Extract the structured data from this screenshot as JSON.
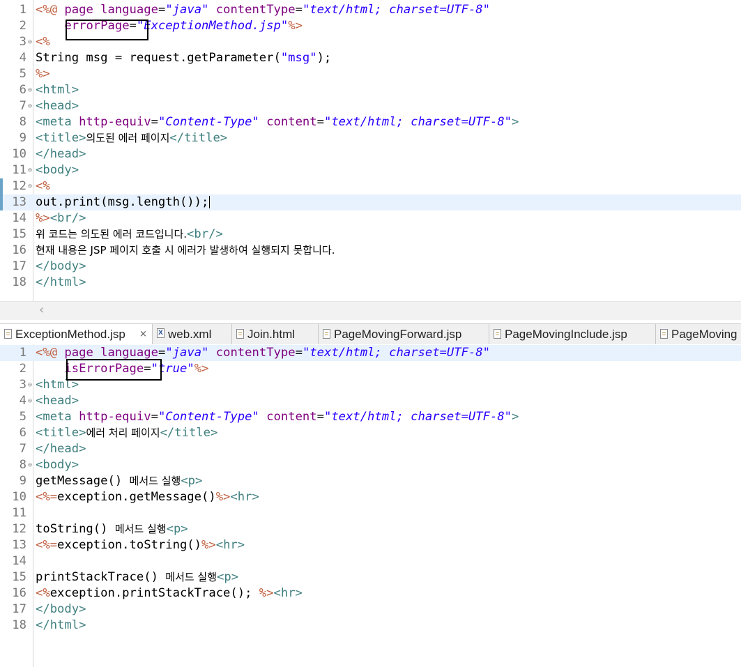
{
  "top_editor": {
    "lines": [
      {
        "n": "1",
        "fold": "",
        "parts": [
          {
            "c": "t-d",
            "t": "<%@ "
          },
          {
            "c": "t-attr",
            "t": "page "
          },
          {
            "c": "t-attr",
            "t": "language"
          },
          {
            "c": "t-eq",
            "t": "="
          },
          {
            "c": "t-str",
            "t": "\"java\""
          },
          {
            "c": "t-eq",
            "t": " "
          },
          {
            "c": "t-attr",
            "t": "contentType"
          },
          {
            "c": "t-eq",
            "t": "="
          },
          {
            "c": "t-str",
            "t": "\"text/html; charset=UTF-8\""
          }
        ]
      },
      {
        "n": "2",
        "fold": "",
        "parts": [
          {
            "c": "t-plain",
            "t": "    "
          },
          {
            "c": "t-attr",
            "t": "errorPage"
          },
          {
            "c": "t-eq",
            "t": "="
          },
          {
            "c": "t-str",
            "t": "\"ExceptionMethod.jsp\""
          },
          {
            "c": "t-d",
            "t": "%>"
          }
        ]
      },
      {
        "n": "3",
        "fold": "⊖",
        "parts": [
          {
            "c": "t-d",
            "t": "<%"
          }
        ]
      },
      {
        "n": "4",
        "fold": "",
        "parts": [
          {
            "c": "t-plain",
            "t": "String msg = request.getParameter("
          },
          {
            "c": "t-jstr",
            "t": "\"msg\""
          },
          {
            "c": "t-plain",
            "t": ");"
          }
        ]
      },
      {
        "n": "5",
        "fold": "",
        "parts": [
          {
            "c": "t-d",
            "t": "%>"
          }
        ]
      },
      {
        "n": "6",
        "fold": "⊖",
        "parts": [
          {
            "c": "t-tag",
            "t": "<html>"
          }
        ]
      },
      {
        "n": "7",
        "fold": "⊖",
        "parts": [
          {
            "c": "t-tag",
            "t": "<head>"
          }
        ]
      },
      {
        "n": "8",
        "fold": "",
        "parts": [
          {
            "c": "t-tag",
            "t": "<meta "
          },
          {
            "c": "t-attr",
            "t": "http-equiv"
          },
          {
            "c": "t-eq",
            "t": "="
          },
          {
            "c": "t-str",
            "t": "\"Content-Type\""
          },
          {
            "c": "t-eq",
            "t": " "
          },
          {
            "c": "t-attr",
            "t": "content"
          },
          {
            "c": "t-eq",
            "t": "="
          },
          {
            "c": "t-str",
            "t": "\"text/html; charset=UTF-8\""
          },
          {
            "c": "t-tag",
            "t": ">"
          }
        ]
      },
      {
        "n": "9",
        "fold": "",
        "parts": [
          {
            "c": "t-tag",
            "t": "<title>"
          },
          {
            "c": "t-plain kr",
            "t": "의도된 에러 페이지"
          },
          {
            "c": "t-tag",
            "t": "</title>"
          }
        ]
      },
      {
        "n": "10",
        "fold": "",
        "parts": [
          {
            "c": "t-tag",
            "t": "</head>"
          }
        ]
      },
      {
        "n": "11",
        "fold": "⊖",
        "parts": [
          {
            "c": "t-tag",
            "t": "<body>"
          }
        ]
      },
      {
        "n": "12",
        "fold": "⊖",
        "mark": true,
        "parts": [
          {
            "c": "t-d",
            "t": "<%"
          }
        ]
      },
      {
        "n": "13",
        "fold": "",
        "mark": true,
        "current": true,
        "caret": true,
        "parts": [
          {
            "c": "t-plain",
            "t": "out.print(msg.length());"
          }
        ]
      },
      {
        "n": "14",
        "fold": "",
        "parts": [
          {
            "c": "t-d",
            "t": "%>"
          },
          {
            "c": "t-tag",
            "t": "<br/>"
          }
        ]
      },
      {
        "n": "15",
        "fold": "",
        "parts": [
          {
            "c": "t-plain kr",
            "t": "위 코드는 의도된 에러 코드입니다."
          },
          {
            "c": "t-tag",
            "t": "<br/>"
          }
        ]
      },
      {
        "n": "16",
        "fold": "",
        "parts": [
          {
            "c": "t-plain kr",
            "t": "현재 내용은 JSP 페이지 호출 시 에러가 발생하여 실행되지 못합니다."
          }
        ]
      },
      {
        "n": "17",
        "fold": "",
        "parts": [
          {
            "c": "t-tag",
            "t": "</body>"
          }
        ]
      },
      {
        "n": "18",
        "fold": "",
        "parts": [
          {
            "c": "t-tag",
            "t": "</html>"
          }
        ]
      }
    ]
  },
  "scrollbar": {
    "left_arrow": "‹"
  },
  "tabs": [
    {
      "label": "ExceptionMethod.jsp",
      "icon": "jsp-file-icon",
      "active": true,
      "close": "×"
    },
    {
      "label": "web.xml",
      "icon": "xml-file-icon",
      "active": false
    },
    {
      "label": "Join.html",
      "icon": "html-file-icon",
      "active": false
    },
    {
      "label": "PageMovingForward.jsp",
      "icon": "jsp-file-icon",
      "active": false
    },
    {
      "label": "PageMovingInclude.jsp",
      "icon": "jsp-file-icon",
      "active": false
    },
    {
      "label": "PageMoving",
      "icon": "jsp-file-icon",
      "active": false
    }
  ],
  "bottom_editor": {
    "lines": [
      {
        "n": "1",
        "fold": "",
        "current": true,
        "parts": [
          {
            "c": "t-d",
            "t": "<%@ "
          },
          {
            "c": "t-attr",
            "t": "page "
          },
          {
            "c": "t-attr",
            "t": "language"
          },
          {
            "c": "t-eq",
            "t": "="
          },
          {
            "c": "t-str",
            "t": "\"java\""
          },
          {
            "c": "t-eq",
            "t": " "
          },
          {
            "c": "t-attr",
            "t": "contentType"
          },
          {
            "c": "t-eq",
            "t": "="
          },
          {
            "c": "t-str",
            "t": "\"text/html; charset=UTF-8\""
          }
        ]
      },
      {
        "n": "2",
        "fold": "",
        "parts": [
          {
            "c": "t-plain",
            "t": "    "
          },
          {
            "c": "t-attr",
            "t": "isErrorPage"
          },
          {
            "c": "t-eq",
            "t": "="
          },
          {
            "c": "t-str",
            "t": "\"true\""
          },
          {
            "c": "t-d",
            "t": "%>"
          }
        ]
      },
      {
        "n": "3",
        "fold": "⊖",
        "parts": [
          {
            "c": "t-tag",
            "t": "<html>"
          }
        ]
      },
      {
        "n": "4",
        "fold": "⊖",
        "parts": [
          {
            "c": "t-tag",
            "t": "<head>"
          }
        ]
      },
      {
        "n": "5",
        "fold": "",
        "parts": [
          {
            "c": "t-tag",
            "t": "<meta "
          },
          {
            "c": "t-attr",
            "t": "http-equiv"
          },
          {
            "c": "t-eq",
            "t": "="
          },
          {
            "c": "t-str",
            "t": "\"Content-Type\""
          },
          {
            "c": "t-eq",
            "t": " "
          },
          {
            "c": "t-attr",
            "t": "content"
          },
          {
            "c": "t-eq",
            "t": "="
          },
          {
            "c": "t-str",
            "t": "\"text/html; charset=UTF-8\""
          },
          {
            "c": "t-tag",
            "t": ">"
          }
        ]
      },
      {
        "n": "6",
        "fold": "",
        "parts": [
          {
            "c": "t-tag",
            "t": "<title>"
          },
          {
            "c": "t-plain kr",
            "t": "에러 처리 페이지"
          },
          {
            "c": "t-tag",
            "t": "</title>"
          }
        ]
      },
      {
        "n": "7",
        "fold": "",
        "parts": [
          {
            "c": "t-tag",
            "t": "</head>"
          }
        ]
      },
      {
        "n": "8",
        "fold": "⊖",
        "parts": [
          {
            "c": "t-tag",
            "t": "<body>"
          }
        ]
      },
      {
        "n": "9",
        "fold": "",
        "parts": [
          {
            "c": "t-plain",
            "t": "getMessage() "
          },
          {
            "c": "t-plain kr",
            "t": "메서드 실행"
          },
          {
            "c": "t-tag",
            "t": "<p>"
          }
        ]
      },
      {
        "n": "10",
        "fold": "",
        "parts": [
          {
            "c": "t-d",
            "t": "<%="
          },
          {
            "c": "t-plain",
            "t": "exception.getMessage()"
          },
          {
            "c": "t-d",
            "t": "%>"
          },
          {
            "c": "t-tag",
            "t": "<hr>"
          }
        ]
      },
      {
        "n": "11",
        "fold": "",
        "parts": []
      },
      {
        "n": "12",
        "fold": "",
        "parts": [
          {
            "c": "t-plain",
            "t": "toString() "
          },
          {
            "c": "t-plain kr",
            "t": "메서드 실행"
          },
          {
            "c": "t-tag",
            "t": "<p>"
          }
        ]
      },
      {
        "n": "13",
        "fold": "",
        "parts": [
          {
            "c": "t-d",
            "t": "<%="
          },
          {
            "c": "t-plain",
            "t": "exception.toString()"
          },
          {
            "c": "t-d",
            "t": "%>"
          },
          {
            "c": "t-tag",
            "t": "<hr>"
          }
        ]
      },
      {
        "n": "14",
        "fold": "",
        "parts": []
      },
      {
        "n": "15",
        "fold": "",
        "parts": [
          {
            "c": "t-plain",
            "t": "printStackTrace() "
          },
          {
            "c": "t-plain kr",
            "t": "메서드 실행"
          },
          {
            "c": "t-tag",
            "t": "<p>"
          }
        ]
      },
      {
        "n": "16",
        "fold": "",
        "parts": [
          {
            "c": "t-d",
            "t": "<%"
          },
          {
            "c": "t-plain",
            "t": "exception.printStackTrace(); "
          },
          {
            "c": "t-d",
            "t": "%>"
          },
          {
            "c": "t-tag",
            "t": "<hr>"
          }
        ]
      },
      {
        "n": "17",
        "fold": "",
        "parts": [
          {
            "c": "t-tag",
            "t": "</body>"
          }
        ]
      },
      {
        "n": "18",
        "fold": "",
        "parts": [
          {
            "c": "t-tag",
            "t": "</html>"
          }
        ]
      }
    ]
  }
}
